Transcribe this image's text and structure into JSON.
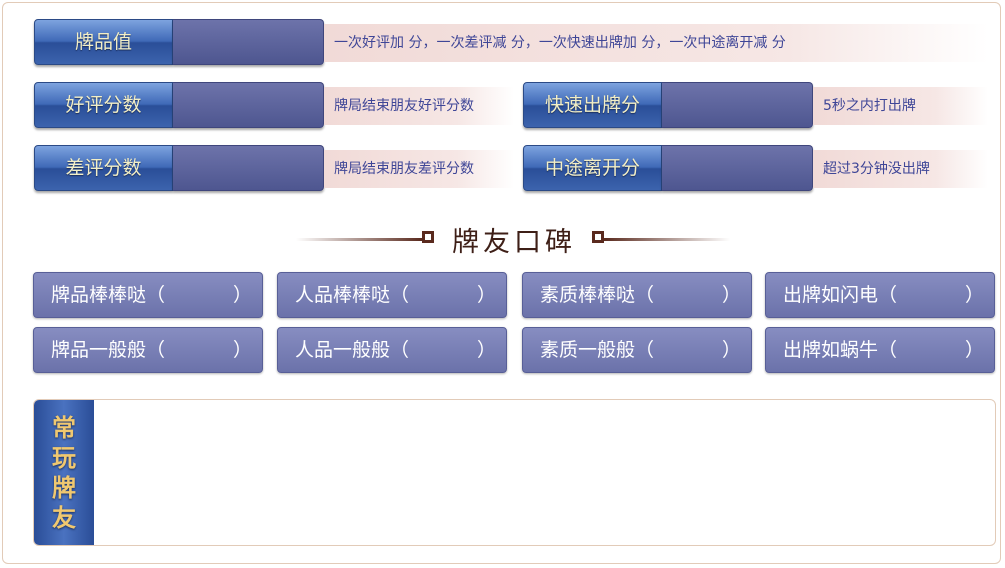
{
  "stats": {
    "rating": {
      "label": "牌品值",
      "desc": "一次好评加      分，一次差评减      分，一次快速出牌加    分，一次中途离开减      分"
    },
    "good_reviews": {
      "label": "好评分数",
      "desc": "牌局结束朋友好评分数"
    },
    "quick_play": {
      "label": "快速出牌分",
      "desc": "5秒之内打出牌"
    },
    "bad_reviews": {
      "label": "差评分数",
      "desc": "牌局结束朋友差评分数"
    },
    "left_midway": {
      "label": "中途离开分",
      "desc": "超过3分钟没出牌"
    }
  },
  "reputation": {
    "title": "牌友口碑",
    "tags": [
      [
        "牌品棒棒哒（",
        "人品棒棒哒（",
        "素质棒棒哒（",
        "出牌如闪电（"
      ],
      [
        "牌品一般般（",
        "人品一般般（",
        "素质一般般（",
        "出牌如蜗牛（"
      ]
    ],
    "close_paren": "）"
  },
  "friends": {
    "label_chars": [
      "常",
      "玩",
      "牌",
      "友"
    ]
  }
}
